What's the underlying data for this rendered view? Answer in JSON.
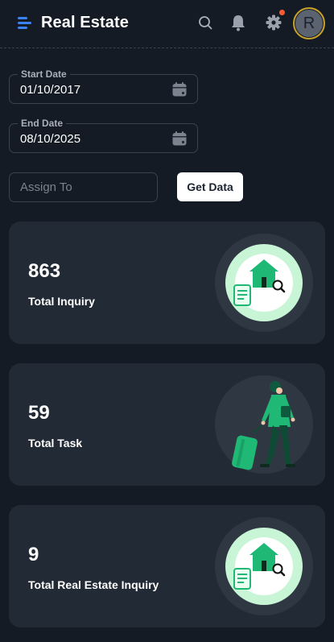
{
  "header": {
    "brand": "Real Estate",
    "icons": [
      "menu-icon",
      "search-icon",
      "bell-icon",
      "gear-icon"
    ],
    "avatar_initial": "R",
    "accent_color": "#3b82f6",
    "notification_color": "#ff5a36"
  },
  "filters": {
    "start_date": {
      "label": "Start Date",
      "value": "01/10/2017"
    },
    "end_date": {
      "label": "End Date",
      "value": "08/10/2025"
    },
    "assign_to": {
      "placeholder": "Assign To",
      "value": ""
    },
    "get_data_label": "Get Data"
  },
  "cards": [
    {
      "value": "863",
      "label": "Total Inquiry",
      "illustration": "house-search"
    },
    {
      "value": "59",
      "label": "Total Task",
      "illustration": "woman-luggage"
    },
    {
      "value": "9",
      "label": "Total Real Estate Inquiry",
      "illustration": "house-search"
    }
  ],
  "colors": {
    "background": "#151b24",
    "card": "#222a35",
    "illustration_green": "#1fb874"
  }
}
